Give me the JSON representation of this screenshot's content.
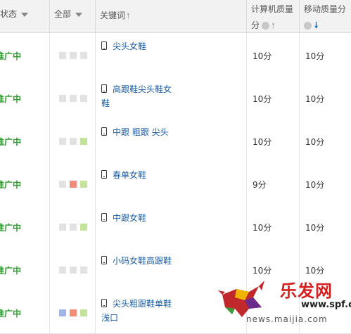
{
  "header": {
    "status_label": "状态",
    "all_label": "全部",
    "keyword_label": "关键词",
    "pc_quality_line1": "计算机质量",
    "pc_quality_line2": "分",
    "mobile_quality_line1": "移动质量分"
  },
  "rows": [
    {
      "status": "推广中",
      "keyword": "尖头女鞋",
      "pc_score": "10分",
      "mobile_score": "10分",
      "dots": [
        "gray",
        "gray",
        "gray"
      ]
    },
    {
      "status": "推广中",
      "keyword": "高跟鞋尖头鞋女鞋",
      "pc_score": "10分",
      "mobile_score": "10分",
      "dots": [
        "gray",
        "gray",
        "gray"
      ]
    },
    {
      "status": "推广中",
      "keyword": "中跟 粗跟 尖头",
      "pc_score": "10分",
      "mobile_score": "10分",
      "dots": [
        "gray",
        "gray",
        "green"
      ]
    },
    {
      "status": "推广中",
      "keyword": "春单女鞋",
      "pc_score": "9分",
      "mobile_score": "10分",
      "dots": [
        "gray",
        "red",
        "green"
      ]
    },
    {
      "status": "推广中",
      "keyword": "中跟女鞋",
      "pc_score": "10分",
      "mobile_score": "10分",
      "dots": [
        "gray",
        "gray",
        "green"
      ]
    },
    {
      "status": "推广中",
      "keyword": "小码女鞋高跟鞋",
      "pc_score": "10分",
      "mobile_score": "10分",
      "dots": [
        "gray",
        "gray",
        "gray"
      ]
    },
    {
      "status": "推广中",
      "keyword": "尖头粗跟鞋单鞋浅口",
      "pc_score": "",
      "mobile_score": "",
      "dots": [
        "blue",
        "red",
        "green"
      ]
    }
  ],
  "watermark": {
    "logo_text": "乐发网",
    "domain_text": "www.spf.cn",
    "url_text": "news.maijia.com"
  },
  "colors": {
    "status_green": "#2e9a2e",
    "keyword_blue": "#1d5fa8",
    "dot_gray": "#e2e2e2",
    "dot_green": "#c4e39a",
    "dot_red": "#f28b7a",
    "dot_blue": "#9fb5e6",
    "sort_desc_blue": "#1a78c8",
    "watermark_red": "#d6201f"
  },
  "icons": {
    "status_filter": "dropdown-triangle-icon",
    "all_filter": "dropdown-triangle-icon",
    "keyword_sort": "sort-up-arrow-icon",
    "pc_help": "help-circle-icon",
    "pc_sort": "sort-up-arrow-icon",
    "mobile_help": "help-circle-icon",
    "mobile_sort": "sort-down-arrow-icon",
    "device": "mobile-phone-icon"
  }
}
